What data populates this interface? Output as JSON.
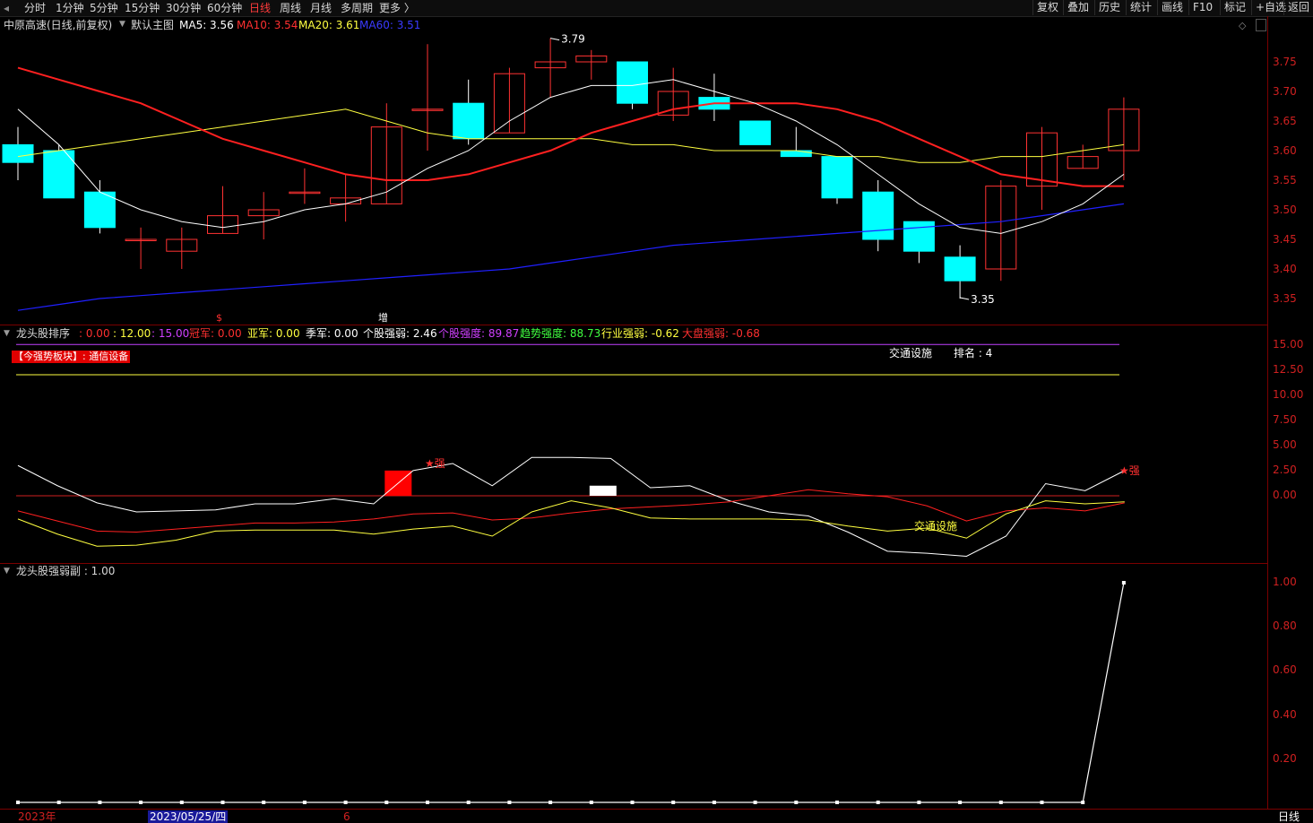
{
  "toolbar": {
    "back_arrow": "◂",
    "periods": [
      "分时",
      "1分钟",
      "5分钟",
      "15分钟",
      "30分钟",
      "60分钟",
      "日线",
      "周线",
      "月线",
      "多周期",
      "更多 〉"
    ],
    "active_period": "日线",
    "right_buttons": [
      "复权",
      "叠加",
      "历史",
      "统计",
      "画线",
      "F10",
      "标记",
      "+自选",
      "返回"
    ]
  },
  "main": {
    "stock_title": "中原高速(日线,前复权)",
    "chart_label": "默认主图",
    "ma5_label": "MA5: 3.56",
    "ma10_label": "MA10: 3.54",
    "ma20_label": "MA20: 3.61",
    "ma60_label": "MA60: 3.51",
    "high_label": "3.79",
    "low_label": "3.35",
    "event_mark_1": "$",
    "event_mark_2": "增"
  },
  "panel2": {
    "title": "龙头股排序",
    "v1": ": 0.00",
    "v2": ": 12.00",
    "v3": ": 15.00",
    "champ": "冠军: 0.00",
    "runner": "亚军: 0.00",
    "third": "季军: 0.00",
    "stock_strength": "个股强弱: 2.46",
    "stock_intensity": "个股强度: 89.87",
    "trend_intensity": "趋势强度: 88.73",
    "industry_strength": "行业强弱: -0.62",
    "market_strength": "大盘强弱: -0.68",
    "sector_tag": "【今强势板块】: 通信设备",
    "industry_name": "交通设施",
    "rank_label": "排名 : 4",
    "star_label": "★强",
    "curve_label": "交通设施"
  },
  "panel3": {
    "title": "龙头股强弱副 : 1.00"
  },
  "axis": {
    "main_ticks": [
      "3.75",
      "3.70",
      "3.65",
      "3.60",
      "3.55",
      "3.50",
      "3.45",
      "3.40",
      "3.35"
    ],
    "panel2_ticks": [
      "15.00",
      "12.50",
      "10.00",
      "7.50",
      "5.00",
      "2.50",
      "0.00"
    ],
    "panel3_ticks": [
      "1.00",
      "0.80",
      "0.60",
      "0.40",
      "0.20"
    ]
  },
  "bottom": {
    "year": "2023年",
    "date_cursor": "2023/05/25/四",
    "month": "6",
    "period": "日线"
  },
  "colors": {
    "up": "#ff3232",
    "down": "#00ffff",
    "ma5": "#ffffff",
    "ma10": "#ff2020",
    "ma20": "#ffff40",
    "ma60": "#2020ff",
    "sep": "#7a0000"
  },
  "chart_data": [
    {
      "type": "candlestick",
      "title": "中原高速(日线,前复权)",
      "ylim": [
        3.32,
        3.8
      ],
      "candles": [
        {
          "o": 3.61,
          "h": 3.64,
          "l": 3.55,
          "c": 3.58
        },
        {
          "o": 3.6,
          "h": 3.61,
          "l": 3.52,
          "c": 3.52
        },
        {
          "o": 3.53,
          "h": 3.55,
          "l": 3.46,
          "c": 3.47
        },
        {
          "o": 3.45,
          "h": 3.47,
          "l": 3.4,
          "c": 3.45
        },
        {
          "o": 3.43,
          "h": 3.47,
          "l": 3.4,
          "c": 3.45
        },
        {
          "o": 3.46,
          "h": 3.54,
          "l": 3.46,
          "c": 3.49
        },
        {
          "o": 3.49,
          "h": 3.53,
          "l": 3.45,
          "c": 3.5
        },
        {
          "o": 3.53,
          "h": 3.57,
          "l": 3.51,
          "c": 3.53
        },
        {
          "o": 3.51,
          "h": 3.56,
          "l": 3.48,
          "c": 3.52
        },
        {
          "o": 3.51,
          "h": 3.68,
          "l": 3.51,
          "c": 3.64
        },
        {
          "o": 3.67,
          "h": 3.78,
          "l": 3.6,
          "c": 3.67
        },
        {
          "o": 3.68,
          "h": 3.72,
          "l": 3.61,
          "c": 3.62
        },
        {
          "o": 3.63,
          "h": 3.74,
          "l": 3.63,
          "c": 3.73
        },
        {
          "o": 3.74,
          "h": 3.79,
          "l": 3.69,
          "c": 3.75
        },
        {
          "o": 3.75,
          "h": 3.77,
          "l": 3.72,
          "c": 3.76
        },
        {
          "o": 3.75,
          "h": 3.75,
          "l": 3.67,
          "c": 3.68
        },
        {
          "o": 3.66,
          "h": 3.74,
          "l": 3.65,
          "c": 3.7
        },
        {
          "o": 3.69,
          "h": 3.73,
          "l": 3.65,
          "c": 3.67
        },
        {
          "o": 3.65,
          "h": 3.65,
          "l": 3.61,
          "c": 3.61
        },
        {
          "o": 3.6,
          "h": 3.64,
          "l": 3.59,
          "c": 3.59
        },
        {
          "o": 3.59,
          "h": 3.59,
          "l": 3.51,
          "c": 3.52
        },
        {
          "o": 3.53,
          "h": 3.55,
          "l": 3.43,
          "c": 3.45
        },
        {
          "o": 3.48,
          "h": 3.48,
          "l": 3.41,
          "c": 3.43
        },
        {
          "o": 3.42,
          "h": 3.44,
          "l": 3.35,
          "c": 3.38
        },
        {
          "o": 3.4,
          "h": 3.55,
          "l": 3.38,
          "c": 3.54
        },
        {
          "o": 3.54,
          "h": 3.64,
          "l": 3.5,
          "c": 3.63
        },
        {
          "o": 3.57,
          "h": 3.61,
          "l": 3.57,
          "c": 3.59
        },
        {
          "o": 3.6,
          "h": 3.69,
          "l": 3.55,
          "c": 3.67
        }
      ],
      "ma5": [
        3.67,
        3.61,
        3.53,
        3.5,
        3.48,
        3.47,
        3.48,
        3.5,
        3.51,
        3.53,
        3.57,
        3.6,
        3.65,
        3.69,
        3.71,
        3.71,
        3.72,
        3.7,
        3.68,
        3.65,
        3.61,
        3.56,
        3.51,
        3.47,
        3.46,
        3.48,
        3.51,
        3.56
      ],
      "ma10": [
        3.74,
        3.72,
        3.7,
        3.68,
        3.65,
        3.62,
        3.6,
        3.58,
        3.56,
        3.55,
        3.55,
        3.56,
        3.58,
        3.6,
        3.63,
        3.65,
        3.67,
        3.68,
        3.68,
        3.68,
        3.67,
        3.65,
        3.62,
        3.59,
        3.56,
        3.55,
        3.54,
        3.54
      ],
      "ma20": [
        3.59,
        3.6,
        3.61,
        3.62,
        3.63,
        3.64,
        3.65,
        3.66,
        3.67,
        3.65,
        3.63,
        3.62,
        3.62,
        3.62,
        3.62,
        3.61,
        3.61,
        3.6,
        3.6,
        3.6,
        3.59,
        3.59,
        3.58,
        3.58,
        3.59,
        3.59,
        3.6,
        3.61
      ],
      "ma60": [
        3.33,
        3.34,
        3.35,
        3.355,
        3.36,
        3.365,
        3.37,
        3.375,
        3.38,
        3.385,
        3.39,
        3.395,
        3.4,
        3.41,
        3.42,
        3.43,
        3.44,
        3.445,
        3.45,
        3.455,
        3.46,
        3.465,
        3.47,
        3.475,
        3.48,
        3.49,
        3.5,
        3.51
      ]
    },
    {
      "type": "line",
      "title": "龙头股排序",
      "ylim": [
        -6.5,
        15.5
      ],
      "hlines": [
        15.0,
        12.0,
        0.0
      ],
      "bars": [
        {
          "index": 9,
          "value": 2.5,
          "color": "#ff0000"
        },
        {
          "index": 14,
          "value": 1.0,
          "color": "#ffffff"
        }
      ],
      "series": [
        {
          "name": "white",
          "values": [
            3.0,
            1.0,
            -0.7,
            -1.6,
            -1.5,
            -1.4,
            -0.8,
            -0.8,
            -0.3,
            -0.8,
            2.5,
            3.2,
            1.0,
            3.8,
            3.8,
            3.7,
            0.8,
            1.0,
            -0.5,
            -1.6,
            -2.0,
            -3.6,
            -5.5,
            -5.7,
            -6.0,
            -4.0,
            1.2,
            0.5,
            2.5
          ]
        },
        {
          "name": "red",
          "values": [
            -1.5,
            -2.5,
            -3.5,
            -3.6,
            -3.3,
            -3.0,
            -2.7,
            -2.7,
            -2.6,
            -2.3,
            -1.8,
            -1.7,
            -2.4,
            -2.2,
            -1.7,
            -1.3,
            -1.1,
            -0.9,
            -0.6,
            0.0,
            0.6,
            0.2,
            -0.1,
            -1.0,
            -2.5,
            -1.5,
            -1.2,
            -1.5,
            -0.7
          ]
        },
        {
          "name": "yellow",
          "values": [
            -2.3,
            -3.8,
            -5.0,
            -4.9,
            -4.4,
            -3.5,
            -3.4,
            -3.4,
            -3.4,
            -3.8,
            -3.3,
            -3.0,
            -4.0,
            -1.6,
            -0.5,
            -1.2,
            -2.2,
            -2.3,
            -2.3,
            -2.3,
            -2.4,
            -3.0,
            -3.5,
            -3.2,
            -4.2,
            -1.8,
            -0.5,
            -0.8,
            -0.6
          ]
        }
      ]
    },
    {
      "type": "line",
      "title": "龙头股强弱副",
      "ylim": [
        0,
        1.05
      ],
      "series": [
        {
          "name": "龙头股强弱副",
          "values": [
            0,
            0,
            0,
            0,
            0,
            0,
            0,
            0,
            0,
            0,
            0,
            0,
            0,
            0,
            0,
            0,
            0,
            0,
            0,
            0,
            0,
            0,
            0,
            0,
            0,
            0,
            0,
            1.0
          ]
        }
      ]
    }
  ]
}
